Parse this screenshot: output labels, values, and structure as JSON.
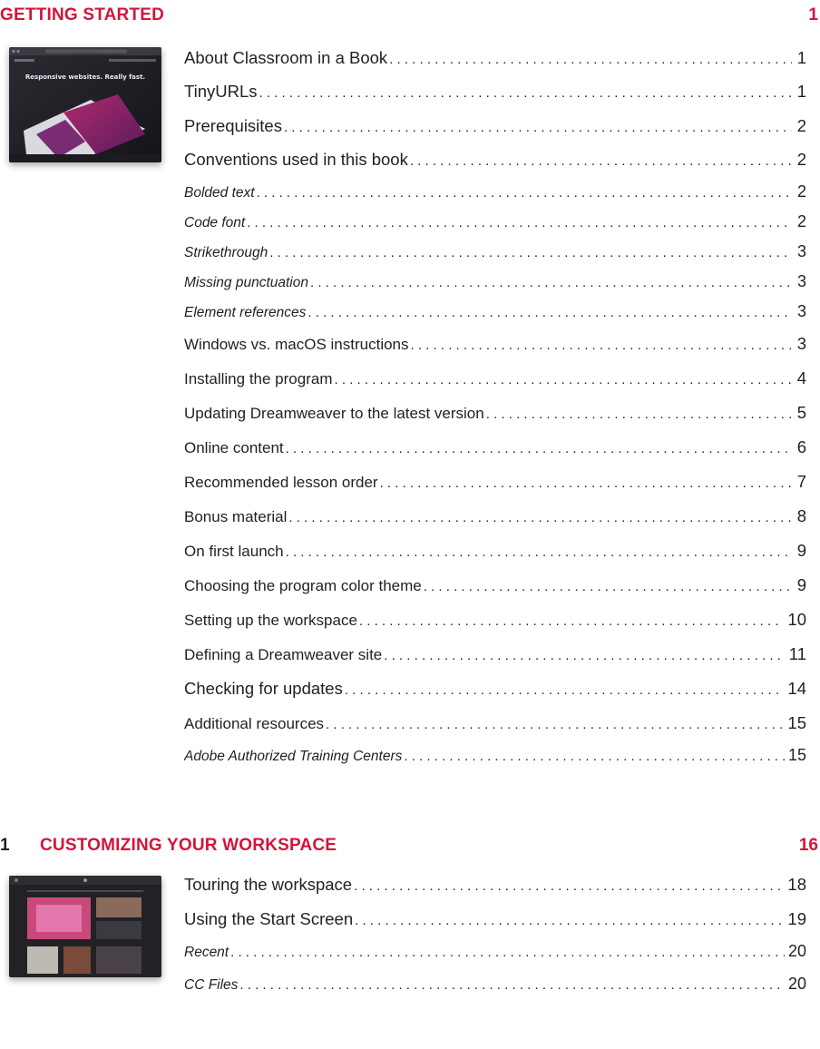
{
  "getting_started": {
    "title": "GETTING STARTED",
    "page": "1",
    "thumbnail_caption": "Responsive websites. Really fast.",
    "entries": [
      {
        "label": "About Classroom in a Book",
        "page": "1",
        "style": "main"
      },
      {
        "label": "TinyURLs",
        "page": "1",
        "style": "main"
      },
      {
        "label": "Prerequisites",
        "page": "2",
        "style": "main"
      },
      {
        "label": "Conventions used in this book",
        "page": "2",
        "style": "main"
      },
      {
        "label": "Bolded text",
        "page": "2",
        "style": "sub"
      },
      {
        "label": "Code font",
        "page": "2",
        "style": "sub"
      },
      {
        "label": "Strikethrough",
        "page": "3",
        "style": "sub"
      },
      {
        "label": "Missing punctuation",
        "page": "3",
        "style": "sub"
      },
      {
        "label": "Element references",
        "page": "3",
        "style": "sub"
      },
      {
        "label": "Windows vs. macOS instructions",
        "page": "3",
        "style": "main-small"
      },
      {
        "label": "Installing the program",
        "page": "4",
        "style": "main-small"
      },
      {
        "label": "Updating Dreamweaver to the latest version",
        "page": "5",
        "style": "main-small"
      },
      {
        "label": "Online content",
        "page": "6",
        "style": "main-small"
      },
      {
        "label": "Recommended lesson order",
        "page": "7",
        "style": "main-small"
      },
      {
        "label": "Bonus material",
        "page": "8",
        "style": "main-small"
      },
      {
        "label": "On first launch",
        "page": "9",
        "style": "main-small"
      },
      {
        "label": "Choosing the program color theme",
        "page": "9",
        "style": "main-small"
      },
      {
        "label": "Setting up the workspace",
        "page": "10",
        "style": "main-small"
      },
      {
        "label": "Defining a Dreamweaver site",
        "page": "11",
        "style": "main-small"
      },
      {
        "label": "Checking for updates",
        "page": "14",
        "style": "main"
      },
      {
        "label": "Additional resources",
        "page": "15",
        "style": "main-small"
      },
      {
        "label": "Adobe Authorized Training Centers",
        "page": "15",
        "style": "sub"
      }
    ]
  },
  "lesson1": {
    "number": "1",
    "title": "CUSTOMIZING YOUR WORKSPACE",
    "page": "16",
    "entries": [
      {
        "label": "Touring the workspace",
        "page": "18",
        "style": "main"
      },
      {
        "label": "Using the Start Screen",
        "page": "19",
        "style": "main"
      },
      {
        "label": "Recent",
        "page": "20",
        "style": "sub"
      },
      {
        "label": "CC Files",
        "page": "20",
        "style": "sub"
      }
    ]
  }
}
